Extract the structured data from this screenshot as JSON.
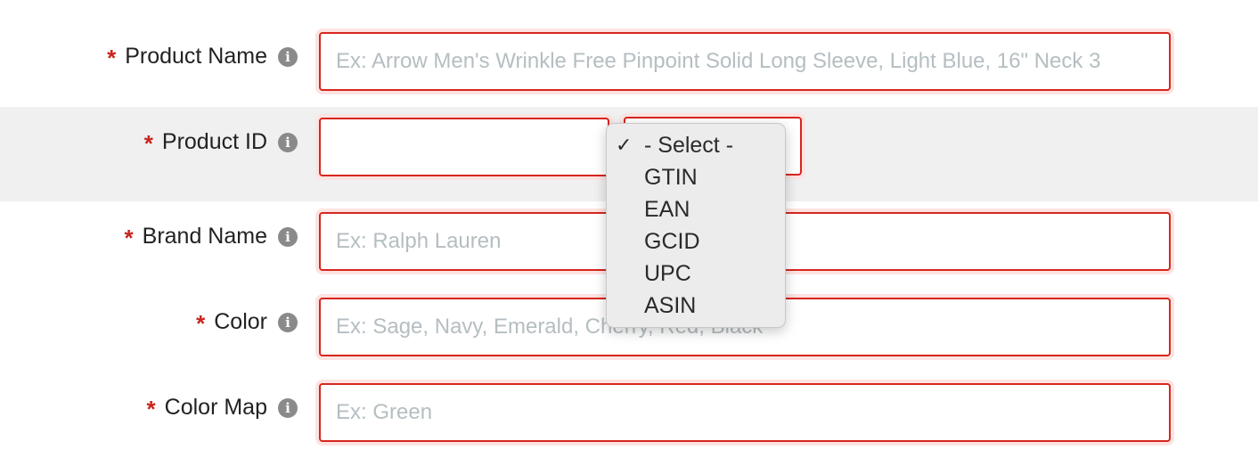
{
  "form": {
    "fields": [
      {
        "key": "product_name",
        "label": "Product Name",
        "required_mark": "*",
        "info_icon": "i",
        "placeholder": "Ex: Arrow Men's Wrinkle Free Pinpoint Solid Long Sleeve, Light Blue, 16\" Neck 3",
        "value": ""
      },
      {
        "key": "product_id",
        "label": "Product ID",
        "required_mark": "*",
        "info_icon": "i",
        "placeholder": "",
        "value": ""
      },
      {
        "key": "brand_name",
        "label": "Brand Name",
        "required_mark": "*",
        "info_icon": "i",
        "placeholder": "Ex: Ralph Lauren",
        "value": ""
      },
      {
        "key": "color",
        "label": "Color",
        "required_mark": "*",
        "info_icon": "i",
        "placeholder": "Ex: Sage, Navy, Emerald, Cherry, Red, Black",
        "value": ""
      },
      {
        "key": "color_map",
        "label": "Color Map",
        "required_mark": "*",
        "info_icon": "i",
        "placeholder": "Ex: Green",
        "value": ""
      }
    ],
    "product_id_type": {
      "selected": "- Select -",
      "check_mark": "✓",
      "options": [
        "- Select -",
        "GTIN",
        "EAN",
        "GCID",
        "UPC",
        "ASIN"
      ]
    }
  },
  "colors": {
    "required": "#c9241c",
    "error_border": "#d7261e",
    "error_glow": "#fde3e1",
    "row_highlight": "#f0f0f0"
  },
  "icons": {
    "info": "info-circle-icon",
    "check": "checkmark-icon"
  }
}
